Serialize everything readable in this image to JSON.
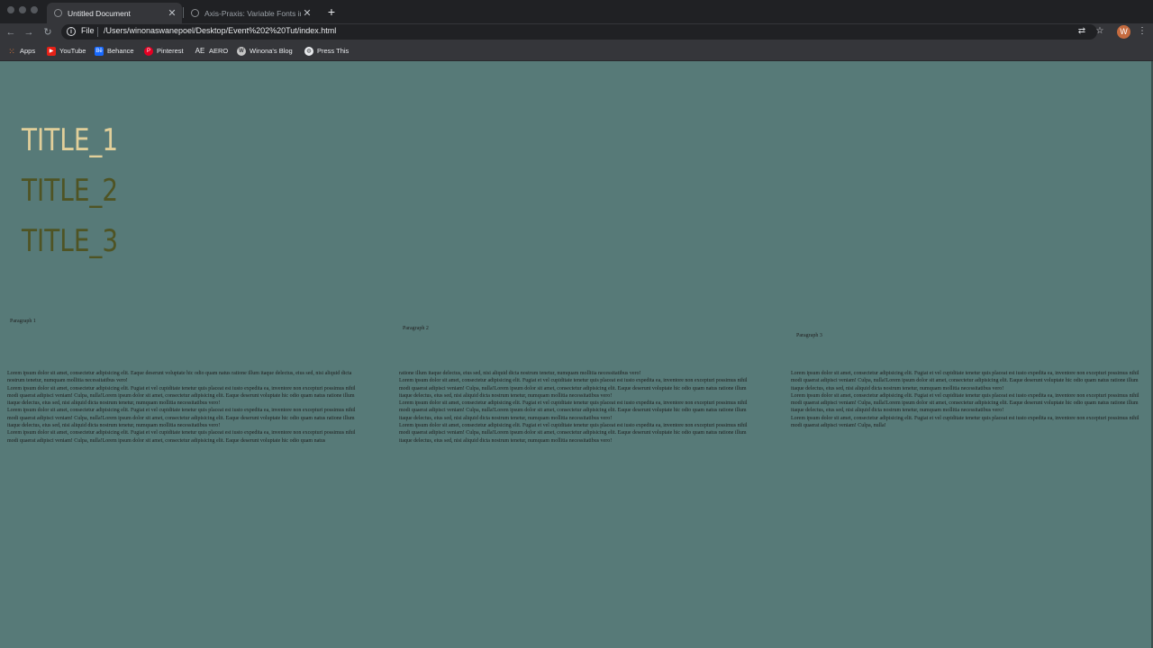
{
  "browser": {
    "tabs": [
      {
        "label": "Untitled Document",
        "active": true
      },
      {
        "label": "Axis-Praxis: Variable Fonts in the",
        "active": false
      }
    ],
    "address": {
      "scheme": "File",
      "url": "/Users/winonaswanepoel/Desktop/Event%202%20Tut/index.html"
    },
    "profile_initial": "W",
    "bookmarks": [
      {
        "label": "Apps",
        "icon": "apps-grid-icon"
      },
      {
        "label": "YouTube",
        "icon": "youtube-icon"
      },
      {
        "label": "Behance",
        "icon": "behance-icon"
      },
      {
        "label": "Pinterest",
        "icon": "pinterest-icon"
      },
      {
        "label": "AERO",
        "icon": "aero-icon"
      },
      {
        "label": "Winona's Blog",
        "icon": "wordpress-icon"
      },
      {
        "label": "Press This",
        "icon": "globe-icon"
      }
    ]
  },
  "page": {
    "titles": [
      "TITLE_1",
      "TITLE_2",
      "TITLE_3"
    ],
    "paragraph_labels": [
      "Paragraph 1",
      "Paragraph 2",
      "Paragraph 3"
    ],
    "paragraphs": [
      "Lorem ipsum dolor sit amet, consectetur adipisicing elit. Eaque deserunt voluptate hic odio quam natus ratione illum itaque delectus, eius sed, nisi aliquid dicta nostrum tenetur, numquam mollitia necessitatibus vero!\nLorem ipsum dolor sit amet, consectetur adipisicing elit. Fugiat et vel cupiditate tenetur quis placeat est iusto expedita ea, inventore non excepturi possimus nihil modi quaerat adipisci veniam! Culpa, nulla!Lorem ipsum dolor sit amet, consectetur adipisicing elit. Eaque deserunt voluptate hic odio quam natus ratione illum itaque delectus, eius sed, nisi aliquid dicta nostrum tenetur, numquam mollitia necessitatibus vero!\nLorem ipsum dolor sit amet, consectetur adipisicing elit. Fugiat et vel cupiditate tenetur quis placeat est iusto expedita ea, inventore non excepturi possimus nihil modi quaerat adipisci veniam! Culpa, nulla!Lorem ipsum dolor sit amet, consectetur adipisicing elit. Eaque deserunt voluptate hic odio quam natus ratione illum itaque delectus, eius sed, nisi aliquid dicta nostrum tenetur, numquam mollitia necessitatibus vero!\nLorem ipsum dolor sit amet, consectetur adipisicing elit. Fugiat et vel cupiditate tenetur quis placeat est iusto expedita ea, inventore non excepturi possimus nihil modi quaerat adipisci veniam! Culpa, nulla!Lorem ipsum dolor sit amet, consectetur adipisicing elit. Eaque deserunt voluptate hic odio quam natus",
      "ratione illum itaque delectus, eius sed, nisi aliquid dicta nostrum tenetur, numquam mollitia necessitatibus vero!\nLorem ipsum dolor sit amet, consectetur adipisicing elit. Fugiat et vel cupiditate tenetur quis placeat est iusto expedita ea, inventore non excepturi possimus nihil modi quaerat adipisci veniam! Culpa, nulla!Lorem ipsum dolor sit amet, consectetur adipisicing elit. Eaque deserunt voluptate hic odio quam natus ratione illum itaque delectus, eius sed, nisi aliquid dicta nostrum tenetur, numquam mollitia necessitatibus vero!\nLorem ipsum dolor sit amet, consectetur adipisicing elit. Fugiat et vel cupiditate tenetur quis placeat est iusto expedita ea, inventore non excepturi possimus nihil modi quaerat adipisci veniam! Culpa, nulla!Lorem ipsum dolor sit amet, consectetur adipisicing elit. Eaque deserunt voluptate hic odio quam natus ratione illum itaque delectus, eius sed, nisi aliquid dicta nostrum tenetur, numquam mollitia necessitatibus vero!\nLorem ipsum dolor sit amet, consectetur adipisicing elit. Fugiat et vel cupiditate tenetur quis placeat est iusto expedita ea, inventore non excepturi possimus nihil modi quaerat adipisci veniam! Culpa, nulla!Lorem ipsum dolor sit amet, consectetur adipisicing elit. Eaque deserunt voluptate hic odio quam natus ratione illum itaque delectus, eius sed, nisi aliquid dicta nostrum tenetur, numquam mollitia necessitatibus vero!",
      "Lorem ipsum dolor sit amet, consectetur adipisicing elit. Fugiat et vel cupiditate tenetur quis placeat est iusto expedita ea, inventore non excepturi possimus nihil modi quaerat adipisci veniam! Culpa, nulla!Lorem ipsum dolor sit amet, consectetur adipisicing elit. Eaque deserunt voluptate hic odio quam natus ratione illum itaque delectus, eius sed, nisi aliquid dicta nostrum tenetur, numquam mollitia necessitatibus vero!\nLorem ipsum dolor sit amet, consectetur adipisicing elit. Fugiat et vel cupiditate tenetur quis placeat est iusto expedita ea, inventore non excepturi possimus nihil modi quaerat adipisci veniam! Culpa, nulla!Lorem ipsum dolor sit amet, consectetur adipisicing elit. Eaque deserunt voluptate hic odio quam natus ratione illum itaque delectus, eius sed, nisi aliquid dicta nostrum tenetur, numquam mollitia necessitatibus vero!\nLorem ipsum dolor sit amet, consectetur adipisicing elit. Fugiat et vel cupiditate tenetur quis placeat est iusto expedita ea, inventore non excepturi possimus nihil modi quaerat adipisci veniam! Culpa, nulla!"
    ]
  },
  "colors": {
    "page_bg": "#577a78",
    "title_1": "#e1cf9a",
    "title_2_3": "#4f5424",
    "chrome_dark": "#202124",
    "chrome_mid": "#35363a"
  }
}
